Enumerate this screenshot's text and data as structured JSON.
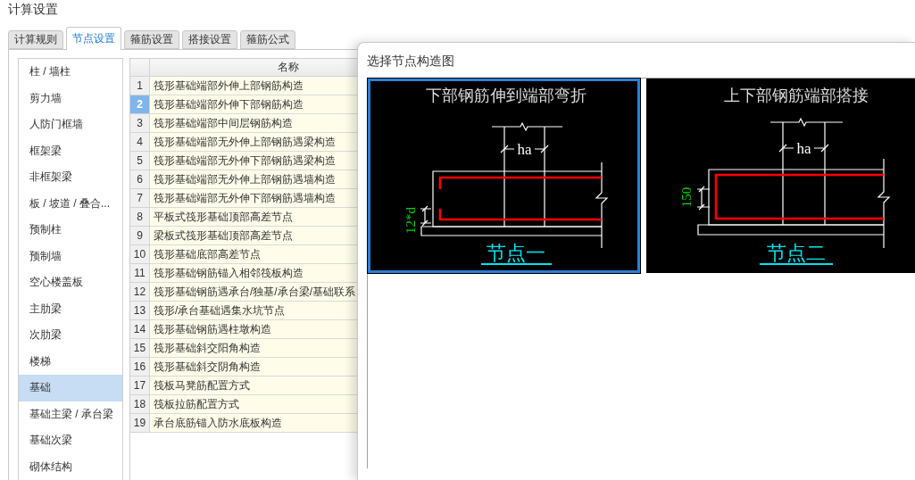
{
  "window": {
    "title": "计算设置"
  },
  "tabs": [
    {
      "label": "计算规则",
      "selected": false
    },
    {
      "label": "节点设置",
      "selected": true
    },
    {
      "label": "箍筋设置",
      "selected": false
    },
    {
      "label": "搭接设置",
      "selected": false
    },
    {
      "label": "箍筋公式",
      "selected": false
    }
  ],
  "sidebar": {
    "items": [
      {
        "label": "柱 / 墙柱",
        "selected": false
      },
      {
        "label": "剪力墙",
        "selected": false
      },
      {
        "label": "人防门框墙",
        "selected": false
      },
      {
        "label": "框架梁",
        "selected": false
      },
      {
        "label": "非框架梁",
        "selected": false
      },
      {
        "label": "板 / 坡道 / 叠合...",
        "selected": false
      },
      {
        "label": "预制柱",
        "selected": false
      },
      {
        "label": "预制墙",
        "selected": false
      },
      {
        "label": "空心楼盖板",
        "selected": false
      },
      {
        "label": "主肋梁",
        "selected": false
      },
      {
        "label": "次肋梁",
        "selected": false
      },
      {
        "label": "楼梯",
        "selected": false
      },
      {
        "label": "基础",
        "selected": true
      },
      {
        "label": "基础主梁 / 承台梁",
        "selected": false
      },
      {
        "label": "基础次梁",
        "selected": false
      },
      {
        "label": "砌体结构",
        "selected": false
      }
    ]
  },
  "table": {
    "columns": [
      "名称"
    ],
    "rows": [
      {
        "number": "1",
        "name": "筏形基础端部外伸上部钢筋构造",
        "selected": false
      },
      {
        "number": "2",
        "name": "筏形基础端部外伸下部钢筋构造",
        "selected": true
      },
      {
        "number": "3",
        "name": "筏形基础端部中间层钢筋构造",
        "selected": false
      },
      {
        "number": "4",
        "name": "筏形基础端部无外伸上部钢筋遇梁构造",
        "selected": false
      },
      {
        "number": "5",
        "name": "筏形基础端部无外伸下部钢筋遇梁构造",
        "selected": false
      },
      {
        "number": "6",
        "name": "筏形基础端部无外伸上部钢筋遇墙构造",
        "selected": false
      },
      {
        "number": "7",
        "name": "筏形基础端部无外伸下部钢筋遇墙构造",
        "selected": false
      },
      {
        "number": "8",
        "name": "平板式筏形基础顶部高差节点",
        "selected": false
      },
      {
        "number": "9",
        "name": "梁板式筏形基础顶部高差节点",
        "selected": false
      },
      {
        "number": "10",
        "name": "筏形基础底部高差节点",
        "selected": false
      },
      {
        "number": "11",
        "name": "筏形基础钢筋锚入相邻筏板构造",
        "selected": false
      },
      {
        "number": "12",
        "name": "筏形基础钢筋遇承台/独基/承台梁/基础联系",
        "selected": false
      },
      {
        "number": "13",
        "name": "筏形/承台基础遇集水坑节点",
        "selected": false
      },
      {
        "number": "14",
        "name": "筏形基础钢筋遇柱墩构造",
        "selected": false
      },
      {
        "number": "15",
        "name": "筏形基础斜交阳角构造",
        "selected": false
      },
      {
        "number": "16",
        "name": "筏形基础斜交阴角构造",
        "selected": false
      },
      {
        "number": "17",
        "name": "筏板马凳筋配置方式",
        "selected": false
      },
      {
        "number": "18",
        "name": "筏板拉筋配置方式",
        "selected": false
      },
      {
        "number": "19",
        "name": "承台底筋锚入防水底板构造",
        "selected": false
      }
    ]
  },
  "dialog": {
    "title": "选择节点构造图",
    "nodes": [
      {
        "kind": "bend",
        "title": "下部钢筋伸到端部弯折",
        "width_label": "ha",
        "dimension_label": "12*d",
        "caption": "节点一",
        "selected": true
      },
      {
        "kind": "lap",
        "title": "上下部钢筋端部搭接",
        "width_label": "ha",
        "dimension_label": "150",
        "caption": "节点二",
        "selected": false
      }
    ]
  }
}
